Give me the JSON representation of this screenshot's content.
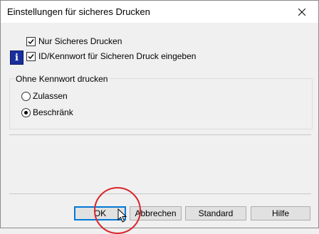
{
  "dialog": {
    "title": "Einstellungen für sicheres Drucken"
  },
  "options": {
    "secure_only_label": "Nur Sicheres Drucken",
    "secure_only_checked": true,
    "enter_id_label": "ID/Kennwort für Sicheren Druck eingeben",
    "enter_id_checked": true
  },
  "group": {
    "legend": "Ohne Kennwort drucken",
    "allow_label": "Zulassen",
    "restrict_label": "Beschränk",
    "selected": "Beschränk"
  },
  "buttons": {
    "ok": "OK",
    "cancel": "Abbrechen",
    "standard": "Standard",
    "help": "Hilfe"
  },
  "icons": {
    "close": "close-icon",
    "info": "info-icon",
    "cursor": "mouse-pointer-icon"
  },
  "colors": {
    "annotation": "#d9262b",
    "info_icon": "#1a2f9c"
  }
}
